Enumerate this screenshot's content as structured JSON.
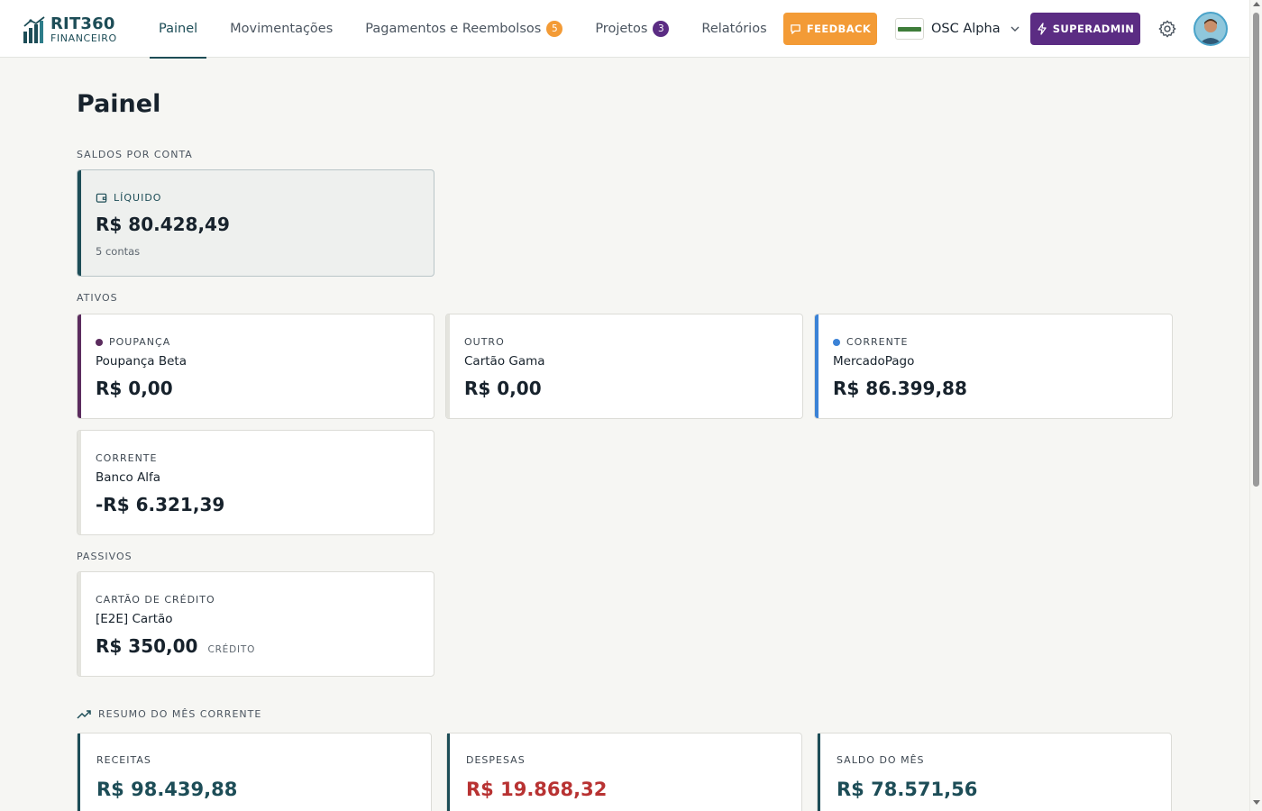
{
  "brand": {
    "name": "RIT360",
    "sub": "FINANCEIRO"
  },
  "nav": {
    "items": [
      {
        "label": "Painel",
        "active": true
      },
      {
        "label": "Movimentações"
      },
      {
        "label": "Pagamentos e Reembolsos",
        "badge": "5",
        "badge_color": "#f39b36"
      },
      {
        "label": "Projetos",
        "badge": "3",
        "badge_color": "#5b2c83"
      },
      {
        "label": "Relatórios"
      }
    ]
  },
  "header": {
    "feedback_label": "FEEDBACK",
    "org_name": "OSC Alpha",
    "superadmin_label": "SUPERADMIN"
  },
  "page": {
    "title": "Painel",
    "balances_label": "SALDOS POR CONTA",
    "liquid": {
      "type": "LÍQUIDO",
      "value": "R$ 80.428,49",
      "sub": "5 contas"
    },
    "assets_label": "ATIVOS",
    "assets": [
      {
        "type": "POUPANÇA",
        "name": "Poupança Beta",
        "value": "R$ 0,00",
        "color": "#5b2c5e"
      },
      {
        "type": "OUTRO",
        "name": "Cartão Gama",
        "value": "R$ 0,00",
        "color": "#e4e4de"
      },
      {
        "type": "CORRENTE",
        "name": "MercadoPago",
        "value": "R$ 86.399,88",
        "color": "#3b82d6"
      },
      {
        "type": "CORRENTE",
        "name": "Banco Alfa",
        "value": "-R$ 6.321,39",
        "color": "#e4e4de"
      }
    ],
    "liabilities_label": "PASSIVOS",
    "liabilities": [
      {
        "type": "CARTÃO DE CRÉDITO",
        "name": "[E2E] Cartão",
        "value": "R$ 350,00",
        "tag": "CRÉDITO"
      }
    ],
    "summary_label": "RESUMO DO MÊS CORRENTE",
    "summary": [
      {
        "label": "RECEITAS",
        "value": "R$ 98.439,88",
        "color": "#1d4d57"
      },
      {
        "label": "DESPESAS",
        "value": "R$ 19.868,32",
        "color": "#b83232"
      },
      {
        "label": "SALDO DO MÊS",
        "value": "R$ 78.571,56",
        "color": "#1d4d57"
      }
    ]
  },
  "colors": {
    "primary": "#1d4d57",
    "accent_orange": "#f39b36",
    "accent_purple": "#5b2c83"
  }
}
